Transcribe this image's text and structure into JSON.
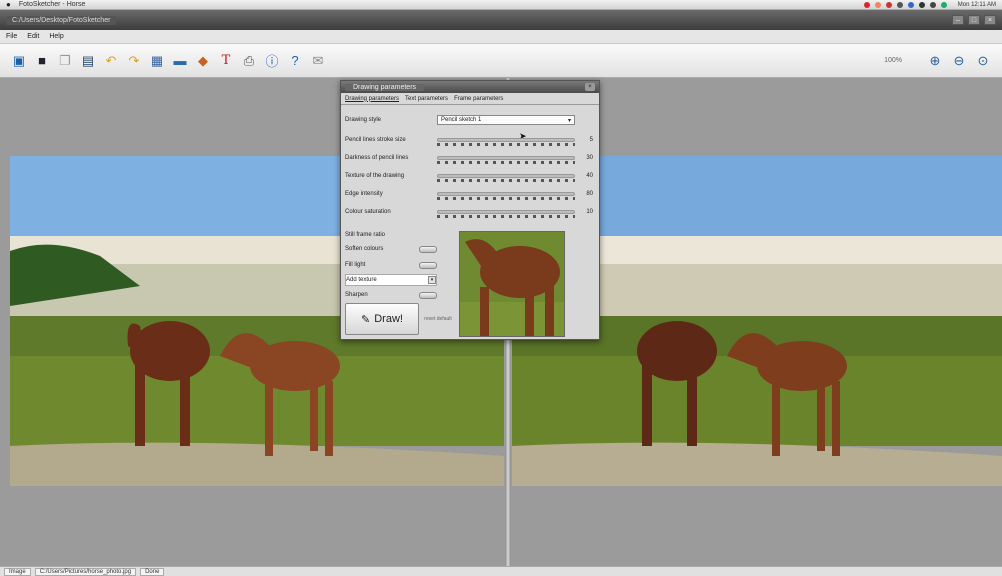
{
  "macbar": {
    "app_title": "FotoSketcher - Horse",
    "clock": "Mon 12:11 AM"
  },
  "window": {
    "path": "C:/Users/Desktop/FotoSketcher"
  },
  "menu": {
    "items": [
      "File",
      "Edit",
      "Help"
    ]
  },
  "toolbar": {
    "icons": [
      "open-icon",
      "save-icon",
      "copy-icon",
      "export-icon",
      "undo-icon",
      "redo-icon",
      "image-icon",
      "landscape-icon",
      "paint-icon",
      "text-icon",
      "print-icon",
      "info-icon",
      "help-icon",
      "mail-icon"
    ],
    "zoom_label": "100%"
  },
  "dialog": {
    "title": "Drawing parameters",
    "tabs": [
      "Drawing parameters",
      "Text parameters",
      "Frame parameters"
    ],
    "style_label": "Drawing style",
    "style_value": "Pencil sketch 1",
    "sliders": [
      {
        "label": "Pencil lines stroke size",
        "value": "5"
      },
      {
        "label": "Darkness of pencil lines",
        "value": "30"
      },
      {
        "label": "Texture of the drawing",
        "value": "40"
      },
      {
        "label": "Edge intensity",
        "value": "80"
      },
      {
        "label": "Colour saturation",
        "value": "10"
      }
    ],
    "options_heading": "Still frame ratio",
    "options": [
      "Soften colours",
      "Fill light",
      "Add texture",
      "Sharpen"
    ],
    "draw_label": "Draw!",
    "reset_label": "reset default"
  },
  "status": {
    "segments": [
      "Image",
      "C:/Users/Pictures/horse_photo.jpg",
      "Done"
    ]
  }
}
